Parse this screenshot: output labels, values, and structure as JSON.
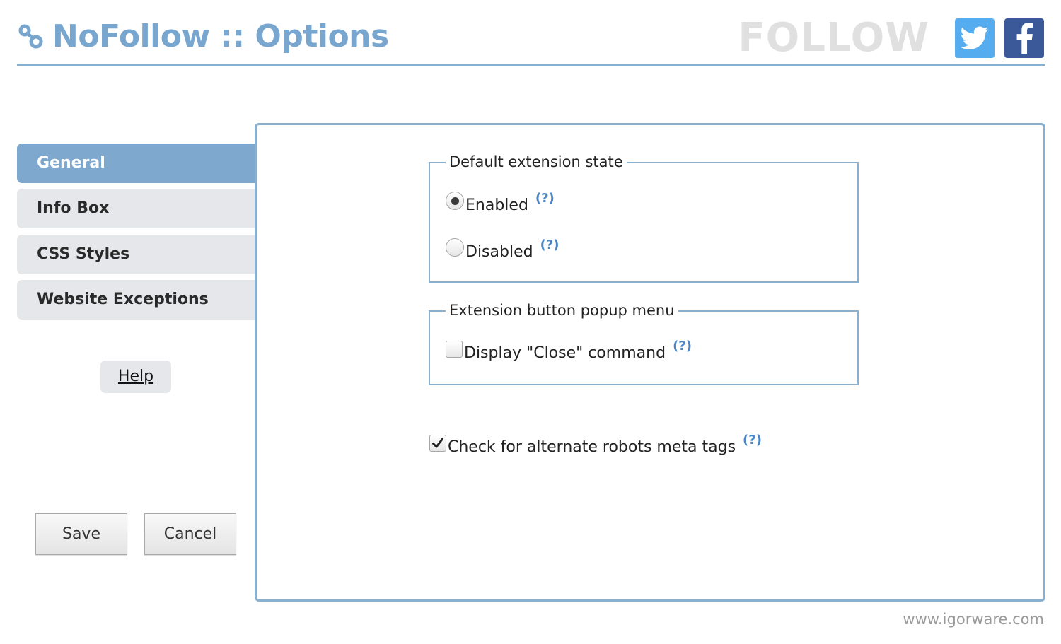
{
  "header": {
    "title": "NoFollow :: Options",
    "follow_text": "FOLLOW",
    "social": [
      {
        "name": "twitter-icon",
        "color": "#55acee"
      },
      {
        "name": "facebook-icon",
        "color": "#3b5998"
      }
    ]
  },
  "sidebar": {
    "items": [
      {
        "label": "General",
        "active": true
      },
      {
        "label": "Info Box",
        "active": false
      },
      {
        "label": "CSS Styles",
        "active": false
      },
      {
        "label": "Website Exceptions",
        "active": false
      }
    ],
    "help_label": "Help"
  },
  "actions": {
    "save_label": "Save",
    "cancel_label": "Cancel"
  },
  "main": {
    "default_state": {
      "legend": "Default extension state",
      "enabled_label": "Enabled",
      "disabled_label": "Disabled",
      "selected": "Enabled"
    },
    "popup_menu": {
      "legend": "Extension button popup menu",
      "close_label": "Display \"Close\" command",
      "close_checked": false
    },
    "robots": {
      "label": "Check for alternate robots meta tags",
      "checked": true
    },
    "help_marker": "(?)"
  },
  "footer": {
    "url": "www.igorware.com"
  },
  "colors": {
    "accent": "#7fa8cf",
    "border": "#8ab0d0",
    "title": "#78a6cf",
    "nav_bg": "#e5e7ea",
    "help_marker": "#4a86c5"
  }
}
